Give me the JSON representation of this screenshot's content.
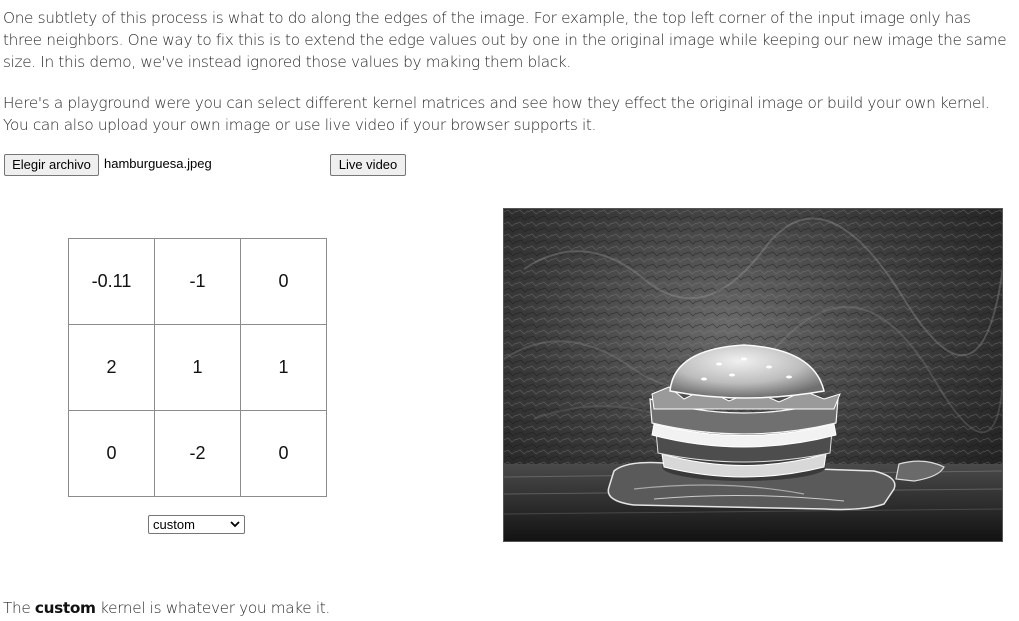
{
  "paragraphs": {
    "edges": "One subtlety of this process is what to do along the edges of the image. For example, the top left corner of the input image only has three neighbors. One way to fix this is to extend the edge values out by one in the original image while keeping our new image the same size. In this demo, we've instead ignored those values by making them black.",
    "playground": "Here's a playground were you can select different kernel matrices and see how they effect the original image or build your own kernel. You can also upload your own image or use live video if your browser supports it."
  },
  "controls": {
    "file_button_label": "Elegir archivo",
    "file_name": "hamburguesa.jpeg",
    "live_video_label": "Live video"
  },
  "kernel": {
    "rows": [
      [
        "-0.11",
        "-1",
        "0"
      ],
      [
        "2",
        "1",
        "1"
      ],
      [
        "0",
        "-2",
        "0"
      ]
    ],
    "selected": "custom"
  },
  "caption": {
    "prefix": "The",
    "kernel_name": "custom",
    "suffix": "kernel is whatever you make it."
  },
  "icons": {
    "select_arrow": "chevron-down-icon"
  }
}
